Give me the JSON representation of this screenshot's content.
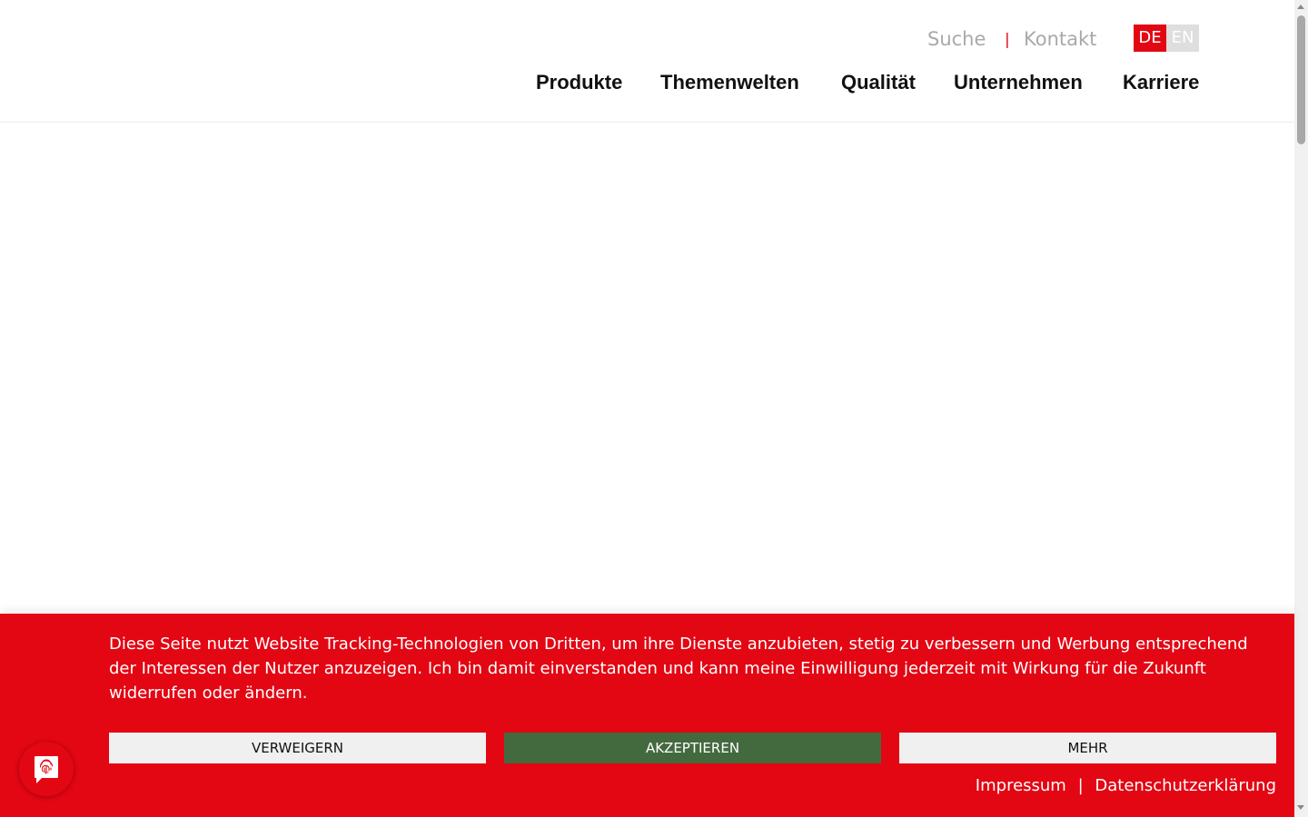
{
  "header": {
    "utility": {
      "search_label": "Suche",
      "separator": "|",
      "contact_label": "Kontakt"
    },
    "languages": [
      {
        "code": "DE",
        "active": true
      },
      {
        "code": "EN",
        "active": false
      }
    ],
    "nav": [
      {
        "label": "Produkte"
      },
      {
        "label": "Themenwelten"
      },
      {
        "label": "Qualität"
      },
      {
        "label": "Unternehmen"
      },
      {
        "label": "Karriere"
      }
    ]
  },
  "cookie_banner": {
    "message": "Diese Seite nutzt Website Tracking-Technologien von Dritten, um ihre Dienste anzubieten, stetig zu verbessern und Werbung entsprechend der Interessen der Nutzer anzuzeigen. Ich bin damit einverstanden und kann meine Einwilligung jederzeit mit Wirkung für die Zukunft widerrufen oder ändern.",
    "deny_label": "VERWEIGERN",
    "accept_label": "AKZEPTIEREN",
    "more_label": "MEHR",
    "imprint_label": "Impressum",
    "links_separator": "|",
    "privacy_label": "Datenschutzerklärung",
    "privacy_settings_icon": "fingerprint-chat-icon"
  },
  "colors": {
    "brand_red": "#e30613",
    "accept_green": "#436a3e",
    "muted_gray": "#a9a9a9",
    "button_light": "#f0f0f0"
  }
}
